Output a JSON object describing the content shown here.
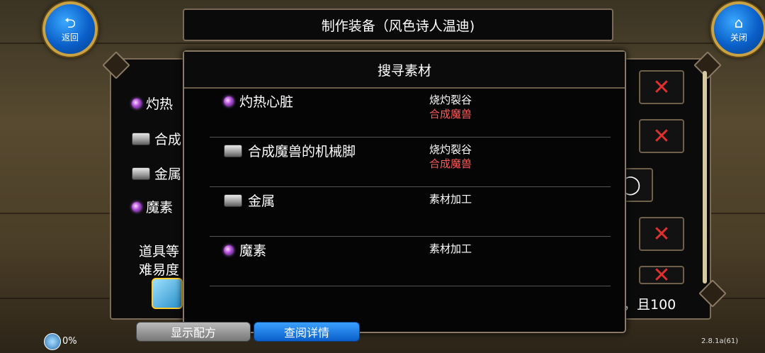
{
  "window": {
    "title": "制作装备（风色诗人温迪)"
  },
  "nav": {
    "back_label": "返回",
    "back_icon": "back-arrow-icon",
    "close_label": "关闭",
    "close_icon": "home-icon"
  },
  "background_list": {
    "items": [
      {
        "label": "灼热",
        "icon": "purple-gem-icon"
      },
      {
        "label": "合成",
        "icon": "metal-ingot-icon"
      },
      {
        "label": "金属",
        "icon": "metal-ingot-icon"
      },
      {
        "label": "魔素",
        "icon": "purple-gem-icon"
      }
    ],
    "item_level_label": "道具等",
    "difficulty_label": "难易度",
    "right_text": "，且100"
  },
  "search_modal": {
    "title": "搜寻素材",
    "rows": [
      {
        "name": "灼热心脏",
        "icon": "purple-gem-icon",
        "source": "烧灼裂谷",
        "enemy": "合成魔兽"
      },
      {
        "name": "合成魔兽的机械脚",
        "icon": "metal-ingot-icon",
        "source": "烧灼裂谷",
        "enemy": "合成魔兽"
      },
      {
        "name": "金属",
        "icon": "metal-ingot-icon",
        "source": "素材加工",
        "enemy": ""
      },
      {
        "name": "魔素",
        "icon": "purple-gem-icon",
        "source": "素材加工",
        "enemy": ""
      }
    ]
  },
  "bottom": {
    "show_recipe": "显示配方",
    "view_details": "查阅详情",
    "progress": "0%",
    "version": "2.8.1a(61)"
  },
  "colors": {
    "accent_red": "#ff5a5a",
    "frame": "#8a7a63",
    "orb_blue": "#0a5fc8"
  }
}
